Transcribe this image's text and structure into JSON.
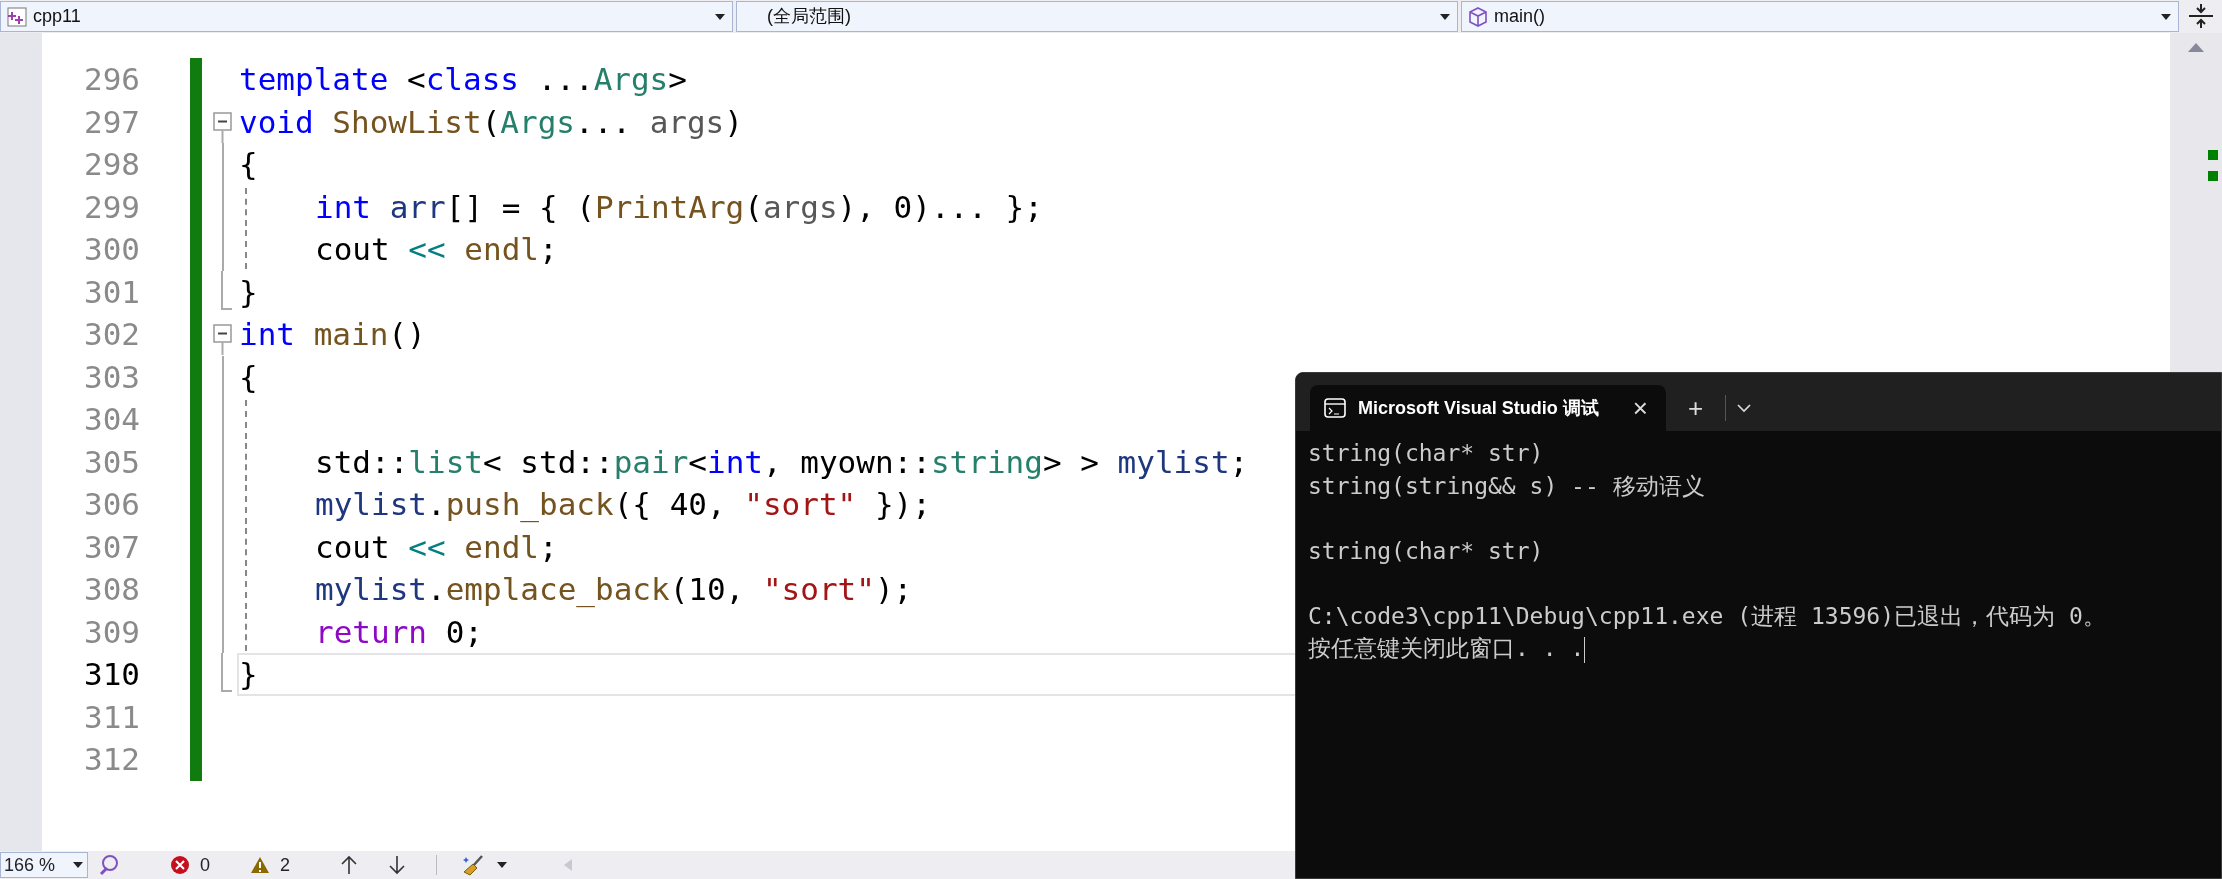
{
  "toolbar": {
    "project": "cpp11",
    "scope": "(全局范围)",
    "member": "main()"
  },
  "lines": [
    {
      "number": "296",
      "kind": "plain",
      "indent": false,
      "changed": true,
      "current": false,
      "tokens": [
        {
          "kind": "kw",
          "text": "template"
        },
        {
          "kind": "plain",
          "text": " <"
        },
        {
          "kind": "kw",
          "text": "class"
        },
        {
          "kind": "plain",
          "text": " ..."
        },
        {
          "kind": "type",
          "text": "Args"
        },
        {
          "kind": "plain",
          "text": ">"
        }
      ]
    },
    {
      "number": "297",
      "kind": "fold-start",
      "indent": false,
      "changed": true,
      "current": false,
      "tokens": [
        {
          "kind": "kw",
          "text": "void "
        },
        {
          "kind": "fn",
          "text": "ShowList"
        },
        {
          "kind": "plain",
          "text": "("
        },
        {
          "kind": "type",
          "text": "Args"
        },
        {
          "kind": "plain",
          "text": "... "
        },
        {
          "kind": "param",
          "text": "args"
        },
        {
          "kind": "plain",
          "text": ")"
        }
      ]
    },
    {
      "number": "298",
      "kind": "fold-body",
      "indent": false,
      "changed": true,
      "current": false,
      "tokens": [
        {
          "kind": "plain",
          "text": "{"
        }
      ]
    },
    {
      "number": "299",
      "kind": "fold-body",
      "indent": true,
      "changed": true,
      "current": false,
      "tokens": [
        {
          "kind": "kw",
          "text": "int "
        },
        {
          "kind": "var",
          "text": "arr"
        },
        {
          "kind": "plain",
          "text": "[] = { ("
        },
        {
          "kind": "fn",
          "text": "PrintArg"
        },
        {
          "kind": "plain",
          "text": "("
        },
        {
          "kind": "param",
          "text": "args"
        },
        {
          "kind": "plain",
          "text": "), 0)... };"
        }
      ]
    },
    {
      "number": "300",
      "kind": "fold-body",
      "indent": true,
      "changed": true,
      "current": false,
      "tokens": [
        {
          "kind": "plain",
          "text": "cout "
        },
        {
          "kind": "op",
          "text": "<< "
        },
        {
          "kind": "fn",
          "text": "endl"
        },
        {
          "kind": "plain",
          "text": ";"
        }
      ]
    },
    {
      "number": "301",
      "kind": "fold-end",
      "indent": false,
      "changed": true,
      "current": false,
      "tokens": [
        {
          "kind": "plain",
          "text": "}"
        }
      ]
    },
    {
      "number": "302",
      "kind": "fold-start",
      "indent": false,
      "changed": true,
      "current": false,
      "tokens": [
        {
          "kind": "kw",
          "text": "int "
        },
        {
          "kind": "fn",
          "text": "main"
        },
        {
          "kind": "plain",
          "text": "()"
        }
      ]
    },
    {
      "number": "303",
      "kind": "fold-body",
      "indent": false,
      "changed": true,
      "current": false,
      "tokens": [
        {
          "kind": "plain",
          "text": "{"
        }
      ]
    },
    {
      "number": "304",
      "kind": "fold-body",
      "indent": true,
      "changed": true,
      "current": false
    },
    {
      "number": "305",
      "kind": "fold-body",
      "indent": true,
      "changed": true,
      "current": false,
      "tokens": [
        {
          "kind": "plain",
          "text": "std::"
        },
        {
          "kind": "type",
          "text": "list"
        },
        {
          "kind": "plain",
          "text": "< std::"
        },
        {
          "kind": "type",
          "text": "pair"
        },
        {
          "kind": "plain",
          "text": "<"
        },
        {
          "kind": "kw",
          "text": "int"
        },
        {
          "kind": "plain",
          "text": ", myown::"
        },
        {
          "kind": "type",
          "text": "string"
        },
        {
          "kind": "plain",
          "text": "> > "
        },
        {
          "kind": "var",
          "text": "mylist"
        },
        {
          "kind": "plain",
          "text": ";"
        }
      ]
    },
    {
      "number": "306",
      "kind": "fold-body",
      "indent": true,
      "changed": true,
      "current": false,
      "tokens": [
        {
          "kind": "var",
          "text": "mylist"
        },
        {
          "kind": "plain",
          "text": "."
        },
        {
          "kind": "fn",
          "text": "push_back"
        },
        {
          "kind": "plain",
          "text": "({ 40, "
        },
        {
          "kind": "str",
          "text": "\"sort\""
        },
        {
          "kind": "plain",
          "text": " });"
        }
      ]
    },
    {
      "number": "307",
      "kind": "fold-body",
      "indent": true,
      "changed": true,
      "current": false,
      "tokens": [
        {
          "kind": "plain",
          "text": "cout "
        },
        {
          "kind": "op",
          "text": "<< "
        },
        {
          "kind": "fn",
          "text": "endl"
        },
        {
          "kind": "plain",
          "text": ";"
        }
      ]
    },
    {
      "number": "308",
      "kind": "fold-body",
      "indent": true,
      "changed": true,
      "current": false,
      "tokens": [
        {
          "kind": "var",
          "text": "mylist"
        },
        {
          "kind": "plain",
          "text": "."
        },
        {
          "kind": "fn",
          "text": "emplace_back"
        },
        {
          "kind": "plain",
          "text": "(10, "
        },
        {
          "kind": "str",
          "text": "\"sort\""
        },
        {
          "kind": "plain",
          "text": ");"
        }
      ]
    },
    {
      "number": "309",
      "kind": "fold-body",
      "indent": true,
      "changed": true,
      "current": false,
      "tokens": [
        {
          "kind": "ctrl",
          "text": "return"
        },
        {
          "kind": "plain",
          "text": " 0;"
        }
      ]
    },
    {
      "number": "310",
      "kind": "fold-end",
      "indent": false,
      "changed": true,
      "current": true,
      "tokens": [
        {
          "kind": "plain",
          "text": "}"
        }
      ]
    },
    {
      "number": "311",
      "kind": "plain",
      "indent": false,
      "changed": true,
      "current": false
    },
    {
      "number": "312",
      "kind": "plain",
      "indent": false,
      "changed": true,
      "current": false
    }
  ],
  "terminal": {
    "tab_title": "Microsoft Visual Studio 调试",
    "close": "×",
    "new_tab": "+",
    "lines": [
      {
        "kind": "text",
        "text": "string(char* str)",
        "cursor": false
      },
      {
        "kind": "text",
        "text": "string(string&& s) -- 移动语义",
        "cursor": false
      },
      {
        "kind": "blank"
      },
      {
        "kind": "text",
        "text": "string(char* str)",
        "cursor": false
      },
      {
        "kind": "blank"
      },
      {
        "kind": "text",
        "text": "C:\\code3\\cpp11\\Debug\\cpp11.exe (进程 13596)已退出，代码为 0。",
        "cursor": false
      },
      {
        "kind": "text",
        "text": "按任意键关闭此窗口. . .",
        "cursor": true
      }
    ]
  },
  "status_bar": {
    "zoom": "166 %",
    "errors": "0",
    "warnings": "2"
  }
}
